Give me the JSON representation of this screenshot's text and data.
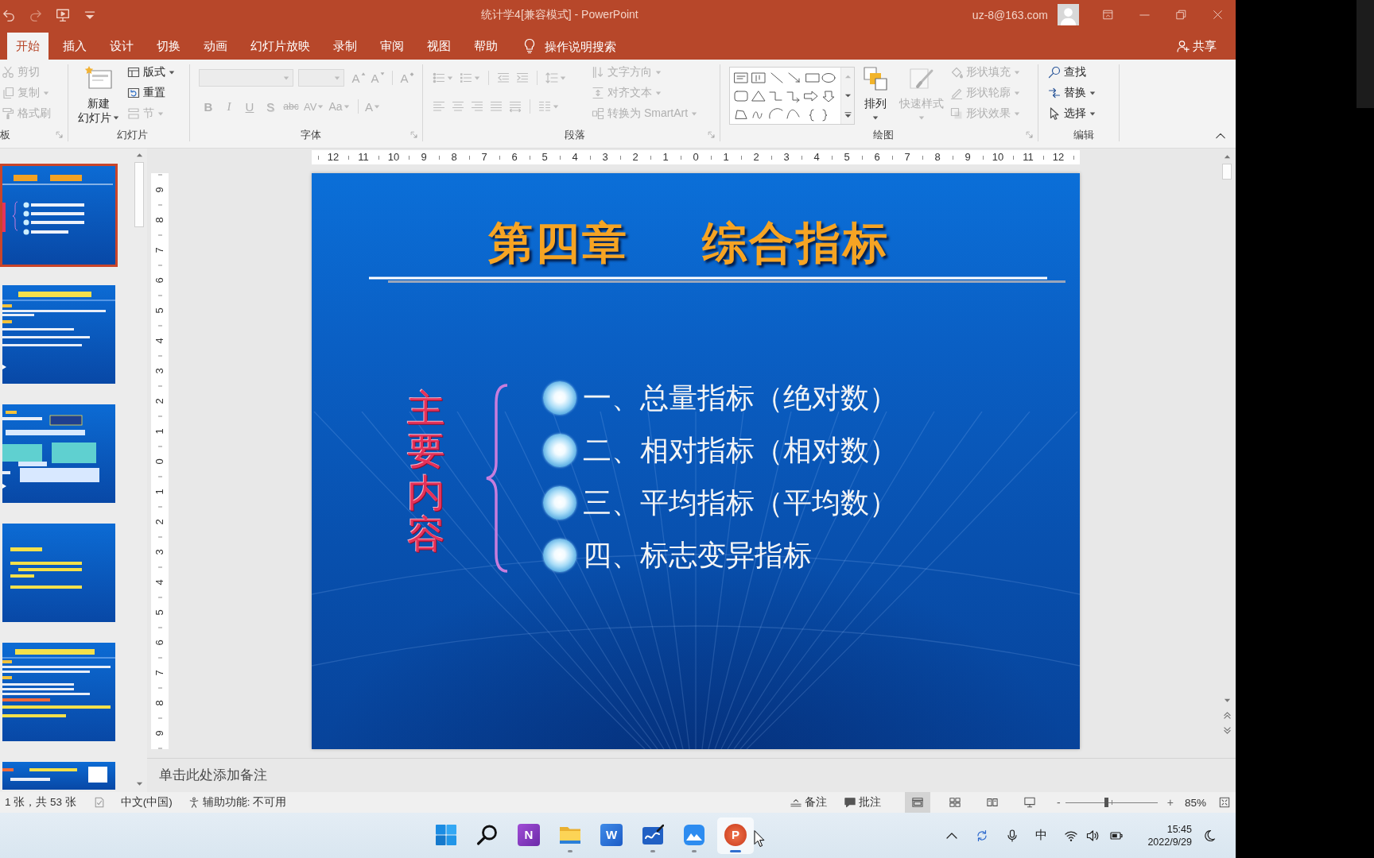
{
  "window": {
    "title": "统计学4[兼容模式] - PowerPoint",
    "account": "uz-8@163.com"
  },
  "quick_access": [
    {
      "kind": "undo",
      "disabled": false
    },
    {
      "kind": "redo",
      "disabled": true
    },
    {
      "kind": "slideshow",
      "disabled": false
    },
    {
      "kind": "customize",
      "disabled": false
    }
  ],
  "tabs": [
    {
      "label": "开始",
      "selected": true
    },
    {
      "label": "插入",
      "selected": false
    },
    {
      "label": "设计",
      "selected": false
    },
    {
      "label": "切换",
      "selected": false
    },
    {
      "label": "动画",
      "selected": false
    },
    {
      "label": "幻灯片放映",
      "selected": false
    },
    {
      "label": "录制",
      "selected": false
    },
    {
      "label": "审阅",
      "selected": false
    },
    {
      "label": "视图",
      "selected": false
    },
    {
      "label": "帮助",
      "selected": false
    }
  ],
  "tell_me": {
    "placeholder": "操作说明搜索"
  },
  "share": {
    "label": "共享"
  },
  "ribbon": {
    "clipboard": {
      "label": "板",
      "launcher": true,
      "commands": [
        {
          "kind": "cut",
          "label": "剪切",
          "dropdown": false,
          "disabled": true
        },
        {
          "kind": "copy",
          "label": "复制",
          "dropdown": true,
          "disabled": true
        },
        {
          "kind": "painter",
          "label": "格式刷",
          "dropdown": false,
          "disabled": true
        }
      ]
    },
    "slides": {
      "label": "幻灯片",
      "new_slide": {
        "lines": [
          "新建",
          "幻灯片"
        ],
        "dropdown": true,
        "disabled": false
      },
      "commands": [
        {
          "kind": "layout",
          "label": "版式",
          "dropdown": true,
          "disabled": false
        },
        {
          "kind": "reset",
          "label": "重置",
          "dropdown": false,
          "disabled": false
        },
        {
          "kind": "section",
          "label": "节",
          "dropdown": true,
          "disabled": true
        }
      ]
    },
    "font": {
      "label": "字体",
      "launcher": true,
      "font_name": {
        "disabled": true
      },
      "font_size": {
        "disabled": true
      },
      "size_buttons": [
        {
          "kind": "grow",
          "label": "A",
          "disabled": true
        },
        {
          "kind": "shrink",
          "label": "A",
          "disabled": true
        },
        {
          "kind": "clear",
          "label": "A",
          "disabled": true
        }
      ],
      "format_buttons": [
        {
          "kind": "bold",
          "label": "B",
          "dropdown": false,
          "disabled": true
        },
        {
          "kind": "italic",
          "label": "I",
          "dropdown": false,
          "disabled": true
        },
        {
          "kind": "underline",
          "label": "U",
          "dropdown": false,
          "disabled": true
        },
        {
          "kind": "shadow",
          "label": "S",
          "dropdown": false,
          "disabled": true
        },
        {
          "kind": "strike",
          "label": "abc",
          "dropdown": false,
          "disabled": true
        },
        {
          "kind": "spacing",
          "label": "AV",
          "dropdown": true,
          "disabled": true
        },
        {
          "kind": "case",
          "label": "Aa",
          "dropdown": true,
          "disabled": true
        },
        {
          "kind": "color",
          "label": "A",
          "dropdown": true,
          "disabled": true
        }
      ]
    },
    "paragraph": {
      "label": "段落",
      "launcher": true,
      "list_buttons": [
        {
          "kind": "bullets",
          "dropdown": true,
          "disabled": true
        },
        {
          "kind": "numbering",
          "dropdown": true,
          "disabled": true
        },
        {
          "kind": "outdent",
          "dropdown": false,
          "disabled": true
        },
        {
          "kind": "indent",
          "dropdown": false,
          "disabled": true
        },
        {
          "kind": "line_spacing",
          "dropdown": true,
          "disabled": true
        }
      ],
      "align_buttons": [
        {
          "kind": "left",
          "dropdown": false,
          "disabled": true
        },
        {
          "kind": "center",
          "dropdown": false,
          "disabled": true
        },
        {
          "kind": "right",
          "dropdown": false,
          "disabled": true
        },
        {
          "kind": "justify",
          "dropdown": false,
          "disabled": true
        },
        {
          "kind": "distribute",
          "dropdown": false,
          "disabled": true
        },
        {
          "kind": "columns",
          "dropdown": true,
          "disabled": true
        }
      ],
      "text_commands": [
        {
          "kind": "direction",
          "label": "文字方向",
          "dropdown": true,
          "disabled": true
        },
        {
          "kind": "align_text",
          "label": "对齐文本",
          "dropdown": true,
          "disabled": true
        },
        {
          "kind": "smartart",
          "label": "转换为 SmartArt",
          "dropdown": true,
          "disabled": true
        }
      ]
    },
    "drawing": {
      "label": "绘图",
      "launcher": true,
      "arrange": {
        "label": "排列",
        "dropdown": true,
        "disabled": false
      },
      "quick_styles": {
        "label": "快速样式",
        "dropdown": true,
        "disabled": true
      },
      "commands": [
        {
          "kind": "fill",
          "label": "形状填充",
          "dropdown": true,
          "disabled": true
        },
        {
          "kind": "outline",
          "label": "形状轮廓",
          "dropdown": true,
          "disabled": true
        },
        {
          "kind": "effects",
          "label": "形状效果",
          "dropdown": true,
          "disabled": true
        }
      ]
    },
    "editing": {
      "label": "编辑",
      "commands": [
        {
          "kind": "find",
          "label": "查找",
          "dropdown": false,
          "disabled": false
        },
        {
          "kind": "replace",
          "label": "替换",
          "dropdown": true,
          "disabled": false
        },
        {
          "kind": "select",
          "label": "选择",
          "dropdown": true,
          "disabled": false
        }
      ]
    }
  },
  "thumbnails": [
    {
      "selected": true
    },
    {
      "selected": false
    },
    {
      "selected": false
    },
    {
      "selected": false
    },
    {
      "selected": false
    },
    {
      "selected": false
    }
  ],
  "rulers": {
    "horizontal": [
      "12",
      "11",
      "10",
      "9",
      "8",
      "7",
      "6",
      "5",
      "4",
      "3",
      "2",
      "1",
      "0",
      "1",
      "2",
      "3",
      "4",
      "5",
      "6",
      "7",
      "8",
      "9",
      "10",
      "11",
      "12"
    ],
    "vertical": [
      "9",
      "8",
      "7",
      "6",
      "5",
      "4",
      "3",
      "2",
      "1",
      "0",
      "1",
      "2",
      "3",
      "4",
      "5",
      "6",
      "7",
      "8",
      "9"
    ]
  },
  "slide": {
    "chapter": "第四章",
    "title": "综合指标",
    "side_label": "主要内容",
    "bullets": [
      "一、总量指标（绝对数）",
      "二、相对指标（相对数）",
      "三、平均指标（平均数）",
      "四、标志变异指标"
    ]
  },
  "notes": {
    "placeholder": "单击此处添加备注"
  },
  "status_bar": {
    "slide_count": "1 张，共 53 张",
    "language": "中文(中国)",
    "accessibility": "辅助功能: 不可用",
    "notes": "备注",
    "comments": "批注",
    "views": [
      {
        "kind": "normal",
        "selected": true
      },
      {
        "kind": "sorter",
        "selected": false
      },
      {
        "kind": "reading",
        "selected": false
      },
      {
        "kind": "slideshow",
        "selected": false
      }
    ],
    "zoom": {
      "minus": "-",
      "plus": "+",
      "level": 0.44,
      "reading": "85%"
    }
  },
  "taskbar": {
    "apps": [
      {
        "kind": "start",
        "running": false,
        "selected": false
      },
      {
        "kind": "search",
        "running": false,
        "selected": false
      },
      {
        "kind": "note",
        "letter": "N",
        "running": false,
        "selected": false
      },
      {
        "kind": "explorer",
        "running": true,
        "selected": false
      },
      {
        "kind": "word",
        "letter": "W",
        "running": false,
        "selected": false
      },
      {
        "kind": "whiteboard",
        "running": true,
        "selected": false
      },
      {
        "kind": "mountain",
        "running": true,
        "selected": false
      },
      {
        "kind": "slides",
        "letter": "P",
        "running": true,
        "selected": true
      }
    ],
    "tray": {
      "ime": "中",
      "time": "15:45",
      "date": "2022/9/29"
    }
  }
}
